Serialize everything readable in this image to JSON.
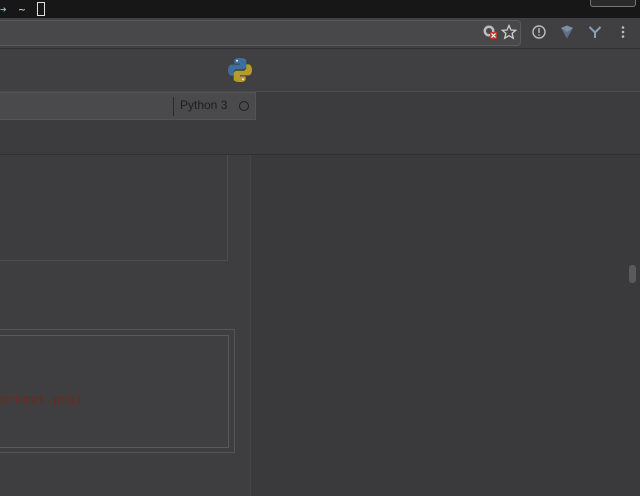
{
  "terminal": {
    "arrow": "➔",
    "tilde": "~"
  },
  "kernel": {
    "name": "Python 3"
  },
  "code_cell": {
    "visible_text": "prompt.png)"
  },
  "icons": {
    "blocked": "blocked-content-icon",
    "star": "star-icon",
    "info": "info-icon",
    "extension_shield": "shield-extension-icon",
    "extension_y": "y-extension-icon",
    "menu": "kebab-menu-icon",
    "logo": "python-logo-icon"
  },
  "colors": {
    "terminal_arrow": "#7fd0c8",
    "code_string": "#6b2a20",
    "python_blue": "#3d6ea0",
    "python_yellow": "#b59a2e"
  }
}
